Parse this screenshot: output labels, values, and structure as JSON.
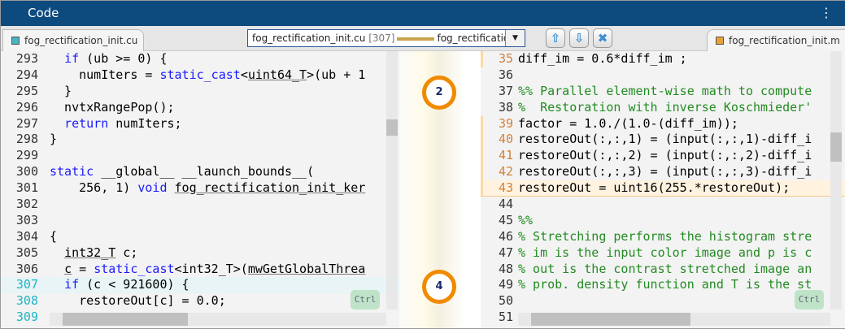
{
  "title": "Code",
  "menu_icon": "vertical-ellipsis",
  "tabs": {
    "left": "fog_rectification_init.cu",
    "right": "fog_rectification_init.m",
    "left_color": "#4bb3c0",
    "right_color": "#e8a23a"
  },
  "trace_dropdown": {
    "source": "fog_rectification_init.cu",
    "line": "[307]",
    "target": "fog_rectification_"
  },
  "nav_buttons": [
    "previous-arrow",
    "next-arrow",
    "close-x"
  ],
  "left_code": [
    {
      "n": "293",
      "t": [
        [
          "  ",
          ""
        ],
        [
          "if",
          "k"
        ],
        [
          " (ub >= 0) {",
          ""
        ]
      ]
    },
    {
      "n": "294",
      "t": [
        [
          "    numIters = ",
          ""
        ],
        [
          "static_cast",
          "k"
        ],
        [
          "<",
          ""
        ],
        [
          "uint64_T",
          "u"
        ],
        [
          ">(ub + 1",
          ""
        ]
      ]
    },
    {
      "n": "295",
      "t": [
        [
          "  }",
          ""
        ]
      ]
    },
    {
      "n": "296",
      "t": [
        [
          "  nvtxRangePop();",
          ""
        ]
      ]
    },
    {
      "n": "297",
      "t": [
        [
          "  ",
          ""
        ],
        [
          "return",
          "k"
        ],
        [
          " numIters;",
          ""
        ]
      ]
    },
    {
      "n": "298",
      "t": [
        [
          "}",
          ""
        ]
      ]
    },
    {
      "n": "299",
      "t": []
    },
    {
      "n": "300",
      "t": [
        [
          "static",
          "k"
        ],
        [
          " __global__ __launch_bounds__(",
          ""
        ]
      ]
    },
    {
      "n": "301",
      "t": [
        [
          "    256, 1) ",
          ""
        ],
        [
          "void",
          "k"
        ],
        [
          " ",
          ""
        ],
        [
          "fog_rectification_init_ker",
          "u"
        ]
      ]
    },
    {
      "n": "302",
      "t": []
    },
    {
      "n": "303",
      "t": []
    },
    {
      "n": "304",
      "t": [
        [
          "{",
          ""
        ]
      ]
    },
    {
      "n": "305",
      "t": [
        [
          "  ",
          ""
        ],
        [
          "int32_T",
          "u"
        ],
        [
          " c;",
          ""
        ]
      ]
    },
    {
      "n": "306",
      "t": [
        [
          "  ",
          ""
        ],
        [
          "c",
          "u"
        ],
        [
          " = ",
          ""
        ],
        [
          "static_cast",
          "k"
        ],
        [
          "<int32_T>(",
          ""
        ],
        [
          "mwGetGlobalThrea",
          "u"
        ]
      ]
    },
    {
      "n": "307",
      "t": [
        [
          "  ",
          ""
        ],
        [
          "if",
          "k"
        ],
        [
          " (c < 921600) {",
          ""
        ]
      ],
      "hl": true
    },
    {
      "n": "308",
      "t": [
        [
          "    restoreOut[c] = 0.0;",
          ""
        ]
      ]
    },
    {
      "n": "309",
      "t": []
    }
  ],
  "right_code": [
    {
      "n": "35",
      "t": [
        [
          "diff_im = 0.6*diff_im ;",
          ""
        ]
      ],
      "mark": true
    },
    {
      "n": "36",
      "t": []
    },
    {
      "n": "37",
      "t": [
        [
          "%% Parallel element-wise math to compute",
          "cm"
        ]
      ]
    },
    {
      "n": "38",
      "t": [
        [
          "%  Restoration with inverse Koschmieder'",
          "cm"
        ]
      ]
    },
    {
      "n": "39",
      "t": [
        [
          "factor = 1.0./(1.0-(diff_im));",
          ""
        ]
      ],
      "mark": true
    },
    {
      "n": "40",
      "t": [
        [
          "restoreOut(:,:,1) = (input(:,:,1)-diff_i",
          ""
        ]
      ],
      "mark": true
    },
    {
      "n": "41",
      "t": [
        [
          "restoreOut(:,:,2) = (input(:,:,2)-diff_i",
          ""
        ]
      ],
      "mark": true
    },
    {
      "n": "42",
      "t": [
        [
          "restoreOut(:,:,3) = (input(:,:,3)-diff_i",
          ""
        ]
      ],
      "mark": true
    },
    {
      "n": "43",
      "t": [
        [
          "restoreOut = uint16(255.*restoreOut);",
          ""
        ]
      ],
      "mark": true,
      "hl": true
    },
    {
      "n": "44",
      "t": []
    },
    {
      "n": "45",
      "t": [
        [
          "%%",
          "cm"
        ]
      ]
    },
    {
      "n": "46",
      "t": [
        [
          "% Stretching performs the histogram stre",
          "cm"
        ]
      ]
    },
    {
      "n": "47",
      "t": [
        [
          "% im is the input color image and p is c",
          "cm"
        ]
      ]
    },
    {
      "n": "48",
      "t": [
        [
          "% out is the contrast stretched image an",
          "cm"
        ]
      ]
    },
    {
      "n": "49",
      "t": [
        [
          "% prob. density function and T is the st",
          "cm"
        ]
      ]
    },
    {
      "n": "50",
      "t": []
    },
    {
      "n": "51",
      "t": []
    }
  ],
  "ctrl_label": "Ctrl",
  "trace_pins": [
    "2",
    "4"
  ],
  "colors": {
    "title_bg": "#0d4a7e",
    "trace_pin": "#f08a00",
    "left_trace_line_num": "#1bb5c4",
    "right_trace_line_num": "#d2803a"
  }
}
